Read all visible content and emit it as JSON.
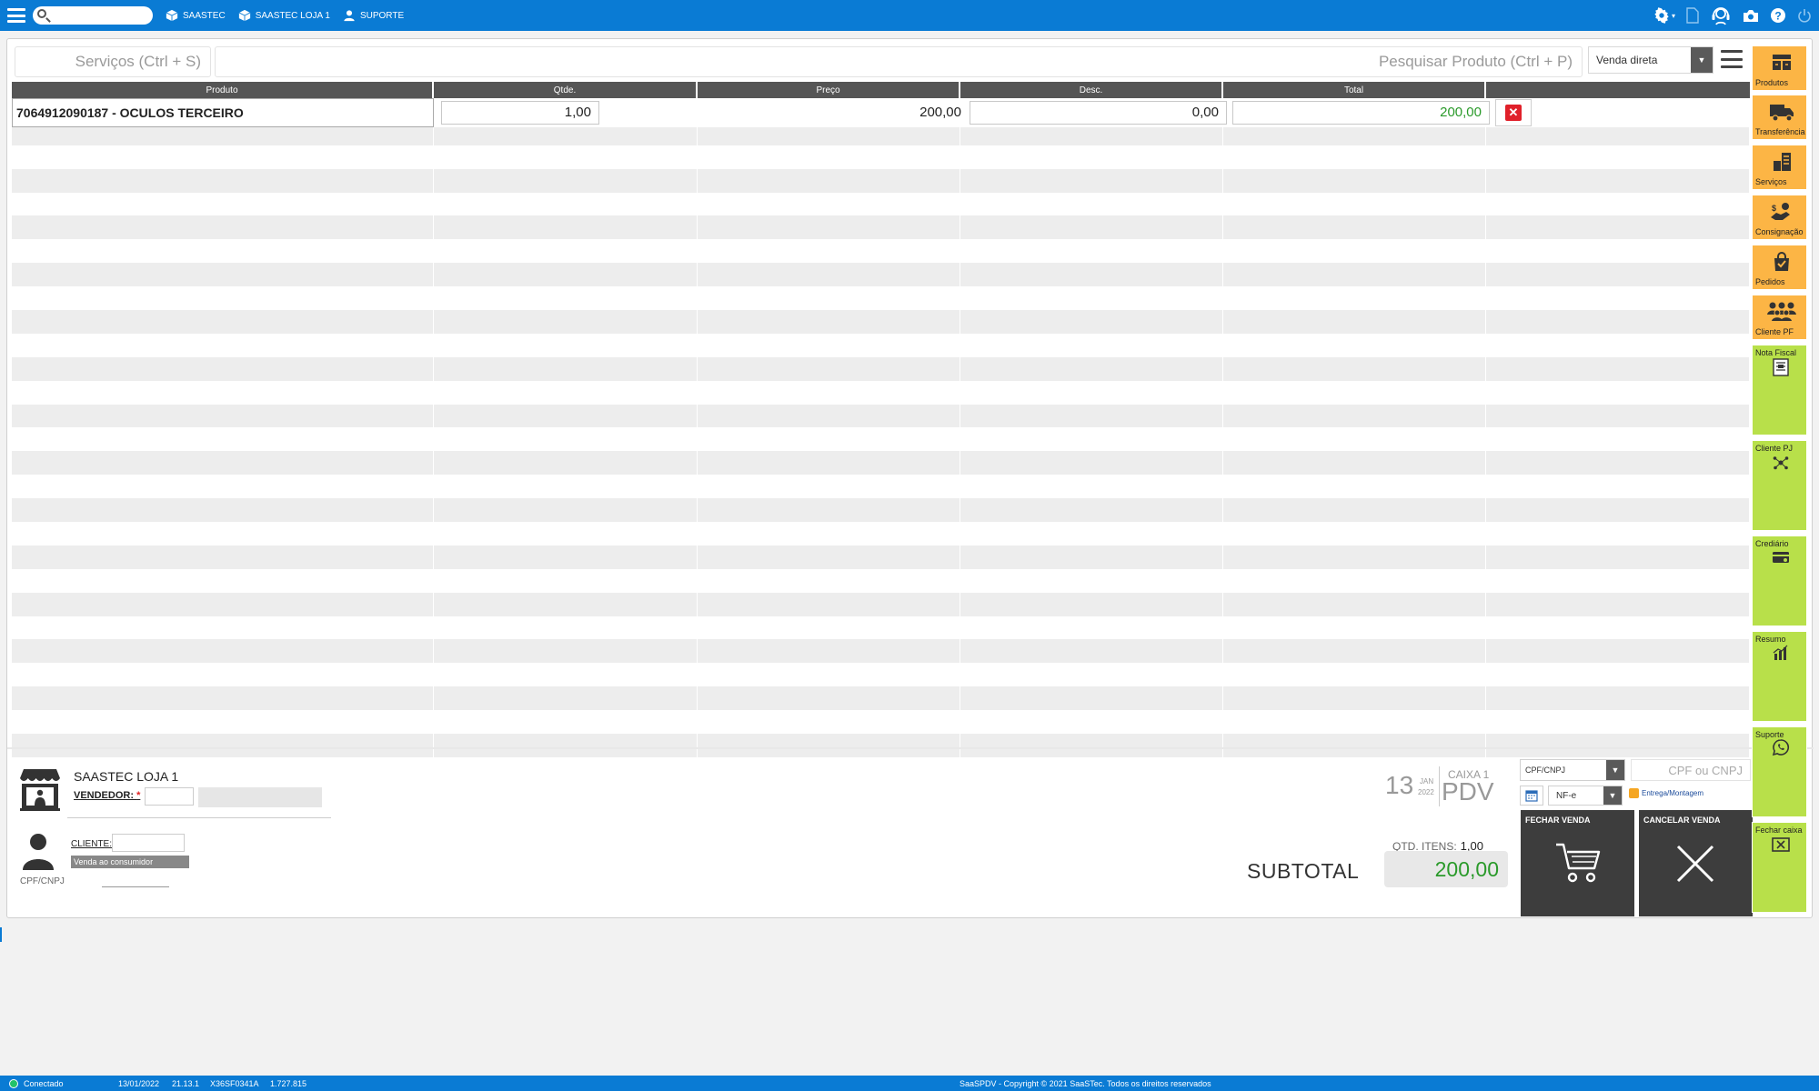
{
  "topbar": {
    "search_placeholder": "",
    "links": [
      "SAASTEC",
      "SAASTEC LOJA 1",
      "SUPORTE"
    ]
  },
  "search": {
    "services_placeholder": "Serviços (Ctrl + S)",
    "products_placeholder": "Pesquisar Produto (Ctrl + P)",
    "sale_type": "Venda direta"
  },
  "grid": {
    "columns": [
      "Produto",
      "Qtde.",
      "Preço",
      "Desc.",
      "Total"
    ],
    "rows": [
      {
        "product": "7064912090187 - OCULOS TERCEIRO",
        "qty": "1,00",
        "price": "200,00",
        "discount": "0,00",
        "total": "200,00"
      }
    ]
  },
  "store": {
    "name": "SAASTEC LOJA 1",
    "vendor_label": "VENDEDOR:",
    "required_mark": "*",
    "client_label": "CLIENTE:",
    "client_sub": "Venda ao consumidor",
    "cpf_label": "CPF/CNPJ"
  },
  "register": {
    "day": "13",
    "month": "JAN",
    "year": "2022",
    "caixa": "CAIXA 1",
    "pdv": "PDV"
  },
  "summary": {
    "qtd_label": "QTD. ITENS:",
    "qtd_value": "1,00",
    "subtotal_label": "SUBTOTAL",
    "subtotal_value": "200,00"
  },
  "doc": {
    "type": "CPF/CNPJ",
    "placeholder": "CPF ou CNPJ",
    "invoice_type": "NF-e",
    "delivery_label": "Entrega/Montagem"
  },
  "actions": {
    "close_sale": "FECHAR VENDA",
    "cancel_sale": "CANCELAR VENDA"
  },
  "sidebar": {
    "items": [
      {
        "label": "Produtos",
        "color": "#fcb545"
      },
      {
        "label": "Transferência",
        "color": "#fcb545"
      },
      {
        "label": "Serviços",
        "color": "#fcb545"
      },
      {
        "label": "Consignação",
        "color": "#fcb545"
      },
      {
        "label": "Pedidos",
        "color": "#fcb545"
      },
      {
        "label": "Cliente PF",
        "color": "#fcb545"
      },
      {
        "label": "Nota Fiscal",
        "color": "#b8e04a"
      },
      {
        "label": "Cliente PJ",
        "color": "#b8e04a"
      },
      {
        "label": "Crediário",
        "color": "#b8e04a"
      },
      {
        "label": "Resumo",
        "color": "#b8e04a"
      },
      {
        "label": "Suporte",
        "color": "#b8e04a"
      },
      {
        "label": "Fechar caixa",
        "color": "#b8e04a"
      }
    ]
  },
  "status": {
    "connection": "Conectado",
    "date": "13/01/2022",
    "version": "21.13.1",
    "terminal": "X36SF0341A",
    "build": "1.727.815",
    "copyright": "SaaSPDV - Copyright © 2021 SaaSTec. Todos os direitos reservados"
  },
  "colors": {
    "topbar": "#0a7bd4",
    "orange": "#fcb545",
    "green": "#b8e04a",
    "total_green": "#2a9a2a",
    "delete_red": "#e0202a"
  }
}
